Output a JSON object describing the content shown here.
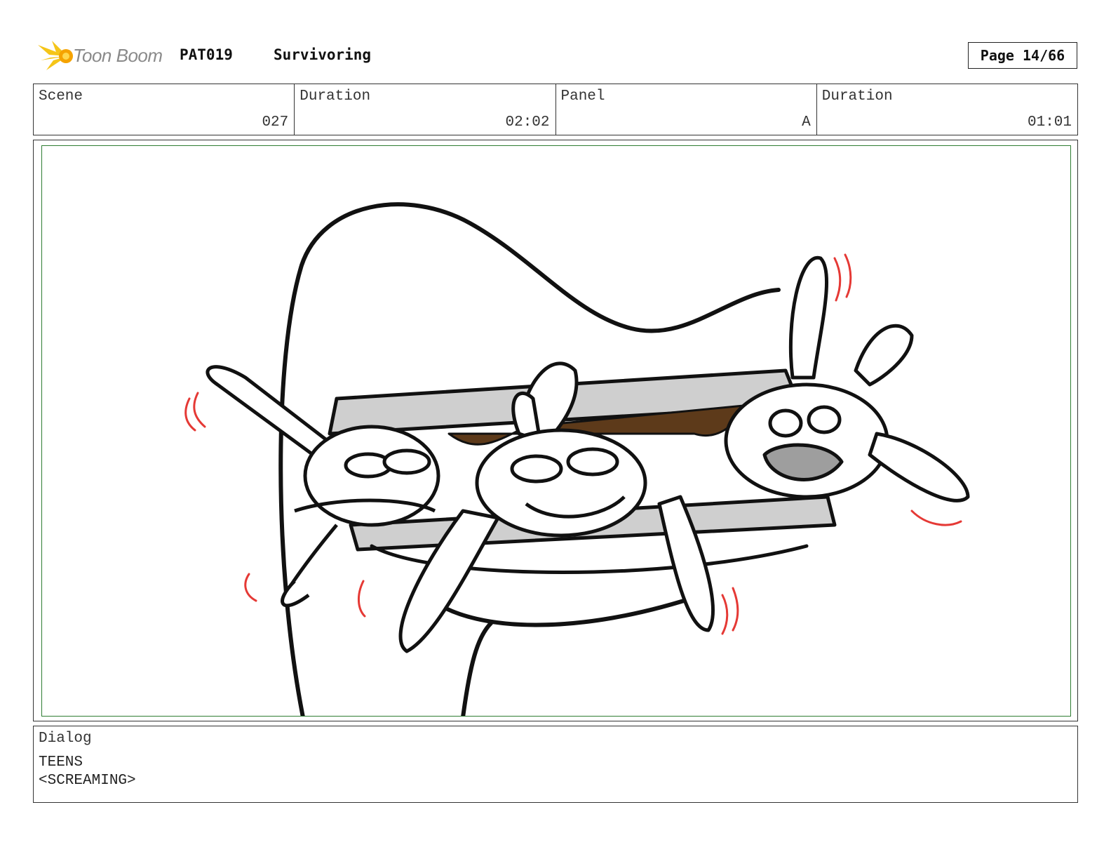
{
  "header": {
    "logo_text": "Toon Boom",
    "production_code": "PAT019",
    "episode_title": "Survivoring",
    "page": "Page 14/66"
  },
  "info": {
    "scene_label": "Scene",
    "scene_value": "027",
    "scene_duration_label": "Duration",
    "scene_duration_value": "02:02",
    "panel_label": "Panel",
    "panel_value": "A",
    "panel_duration_label": "Duration",
    "panel_duration_value": "01:01"
  },
  "dialog": {
    "label": "Dialog",
    "speaker": "TEENS",
    "line": "<SCREAMING>"
  },
  "colors": {
    "frame_border": "#2e7d32",
    "shake_lines": "#e53935",
    "logo_flare": "#f5c518"
  }
}
